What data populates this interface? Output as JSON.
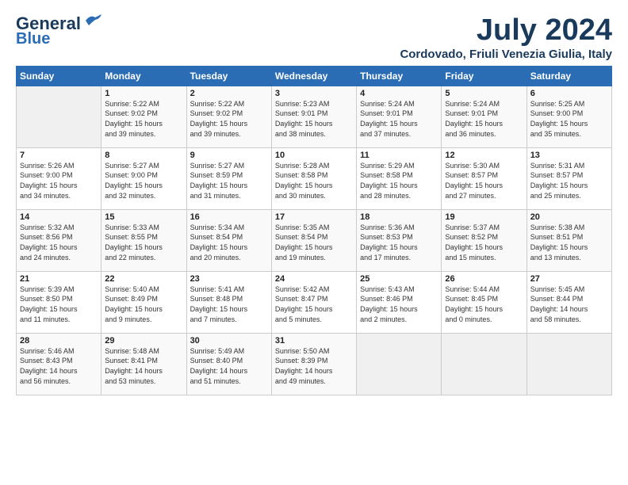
{
  "logo": {
    "line1": "General",
    "line2": "Blue"
  },
  "title": "July 2024",
  "subtitle": "Cordovado, Friuli Venezia Giulia, Italy",
  "headers": [
    "Sunday",
    "Monday",
    "Tuesday",
    "Wednesday",
    "Thursday",
    "Friday",
    "Saturday"
  ],
  "weeks": [
    [
      {
        "day": "",
        "info": ""
      },
      {
        "day": "1",
        "info": "Sunrise: 5:22 AM\nSunset: 9:02 PM\nDaylight: 15 hours\nand 39 minutes."
      },
      {
        "day": "2",
        "info": "Sunrise: 5:22 AM\nSunset: 9:02 PM\nDaylight: 15 hours\nand 39 minutes."
      },
      {
        "day": "3",
        "info": "Sunrise: 5:23 AM\nSunset: 9:01 PM\nDaylight: 15 hours\nand 38 minutes."
      },
      {
        "day": "4",
        "info": "Sunrise: 5:24 AM\nSunset: 9:01 PM\nDaylight: 15 hours\nand 37 minutes."
      },
      {
        "day": "5",
        "info": "Sunrise: 5:24 AM\nSunset: 9:01 PM\nDaylight: 15 hours\nand 36 minutes."
      },
      {
        "day": "6",
        "info": "Sunrise: 5:25 AM\nSunset: 9:00 PM\nDaylight: 15 hours\nand 35 minutes."
      }
    ],
    [
      {
        "day": "7",
        "info": "Sunrise: 5:26 AM\nSunset: 9:00 PM\nDaylight: 15 hours\nand 34 minutes."
      },
      {
        "day": "8",
        "info": "Sunrise: 5:27 AM\nSunset: 9:00 PM\nDaylight: 15 hours\nand 32 minutes."
      },
      {
        "day": "9",
        "info": "Sunrise: 5:27 AM\nSunset: 8:59 PM\nDaylight: 15 hours\nand 31 minutes."
      },
      {
        "day": "10",
        "info": "Sunrise: 5:28 AM\nSunset: 8:58 PM\nDaylight: 15 hours\nand 30 minutes."
      },
      {
        "day": "11",
        "info": "Sunrise: 5:29 AM\nSunset: 8:58 PM\nDaylight: 15 hours\nand 28 minutes."
      },
      {
        "day": "12",
        "info": "Sunrise: 5:30 AM\nSunset: 8:57 PM\nDaylight: 15 hours\nand 27 minutes."
      },
      {
        "day": "13",
        "info": "Sunrise: 5:31 AM\nSunset: 8:57 PM\nDaylight: 15 hours\nand 25 minutes."
      }
    ],
    [
      {
        "day": "14",
        "info": "Sunrise: 5:32 AM\nSunset: 8:56 PM\nDaylight: 15 hours\nand 24 minutes."
      },
      {
        "day": "15",
        "info": "Sunrise: 5:33 AM\nSunset: 8:55 PM\nDaylight: 15 hours\nand 22 minutes."
      },
      {
        "day": "16",
        "info": "Sunrise: 5:34 AM\nSunset: 8:54 PM\nDaylight: 15 hours\nand 20 minutes."
      },
      {
        "day": "17",
        "info": "Sunrise: 5:35 AM\nSunset: 8:54 PM\nDaylight: 15 hours\nand 19 minutes."
      },
      {
        "day": "18",
        "info": "Sunrise: 5:36 AM\nSunset: 8:53 PM\nDaylight: 15 hours\nand 17 minutes."
      },
      {
        "day": "19",
        "info": "Sunrise: 5:37 AM\nSunset: 8:52 PM\nDaylight: 15 hours\nand 15 minutes."
      },
      {
        "day": "20",
        "info": "Sunrise: 5:38 AM\nSunset: 8:51 PM\nDaylight: 15 hours\nand 13 minutes."
      }
    ],
    [
      {
        "day": "21",
        "info": "Sunrise: 5:39 AM\nSunset: 8:50 PM\nDaylight: 15 hours\nand 11 minutes."
      },
      {
        "day": "22",
        "info": "Sunrise: 5:40 AM\nSunset: 8:49 PM\nDaylight: 15 hours\nand 9 minutes."
      },
      {
        "day": "23",
        "info": "Sunrise: 5:41 AM\nSunset: 8:48 PM\nDaylight: 15 hours\nand 7 minutes."
      },
      {
        "day": "24",
        "info": "Sunrise: 5:42 AM\nSunset: 8:47 PM\nDaylight: 15 hours\nand 5 minutes."
      },
      {
        "day": "25",
        "info": "Sunrise: 5:43 AM\nSunset: 8:46 PM\nDaylight: 15 hours\nand 2 minutes."
      },
      {
        "day": "26",
        "info": "Sunrise: 5:44 AM\nSunset: 8:45 PM\nDaylight: 15 hours\nand 0 minutes."
      },
      {
        "day": "27",
        "info": "Sunrise: 5:45 AM\nSunset: 8:44 PM\nDaylight: 14 hours\nand 58 minutes."
      }
    ],
    [
      {
        "day": "28",
        "info": "Sunrise: 5:46 AM\nSunset: 8:43 PM\nDaylight: 14 hours\nand 56 minutes."
      },
      {
        "day": "29",
        "info": "Sunrise: 5:48 AM\nSunset: 8:41 PM\nDaylight: 14 hours\nand 53 minutes."
      },
      {
        "day": "30",
        "info": "Sunrise: 5:49 AM\nSunset: 8:40 PM\nDaylight: 14 hours\nand 51 minutes."
      },
      {
        "day": "31",
        "info": "Sunrise: 5:50 AM\nSunset: 8:39 PM\nDaylight: 14 hours\nand 49 minutes."
      },
      {
        "day": "",
        "info": ""
      },
      {
        "day": "",
        "info": ""
      },
      {
        "day": "",
        "info": ""
      }
    ]
  ]
}
